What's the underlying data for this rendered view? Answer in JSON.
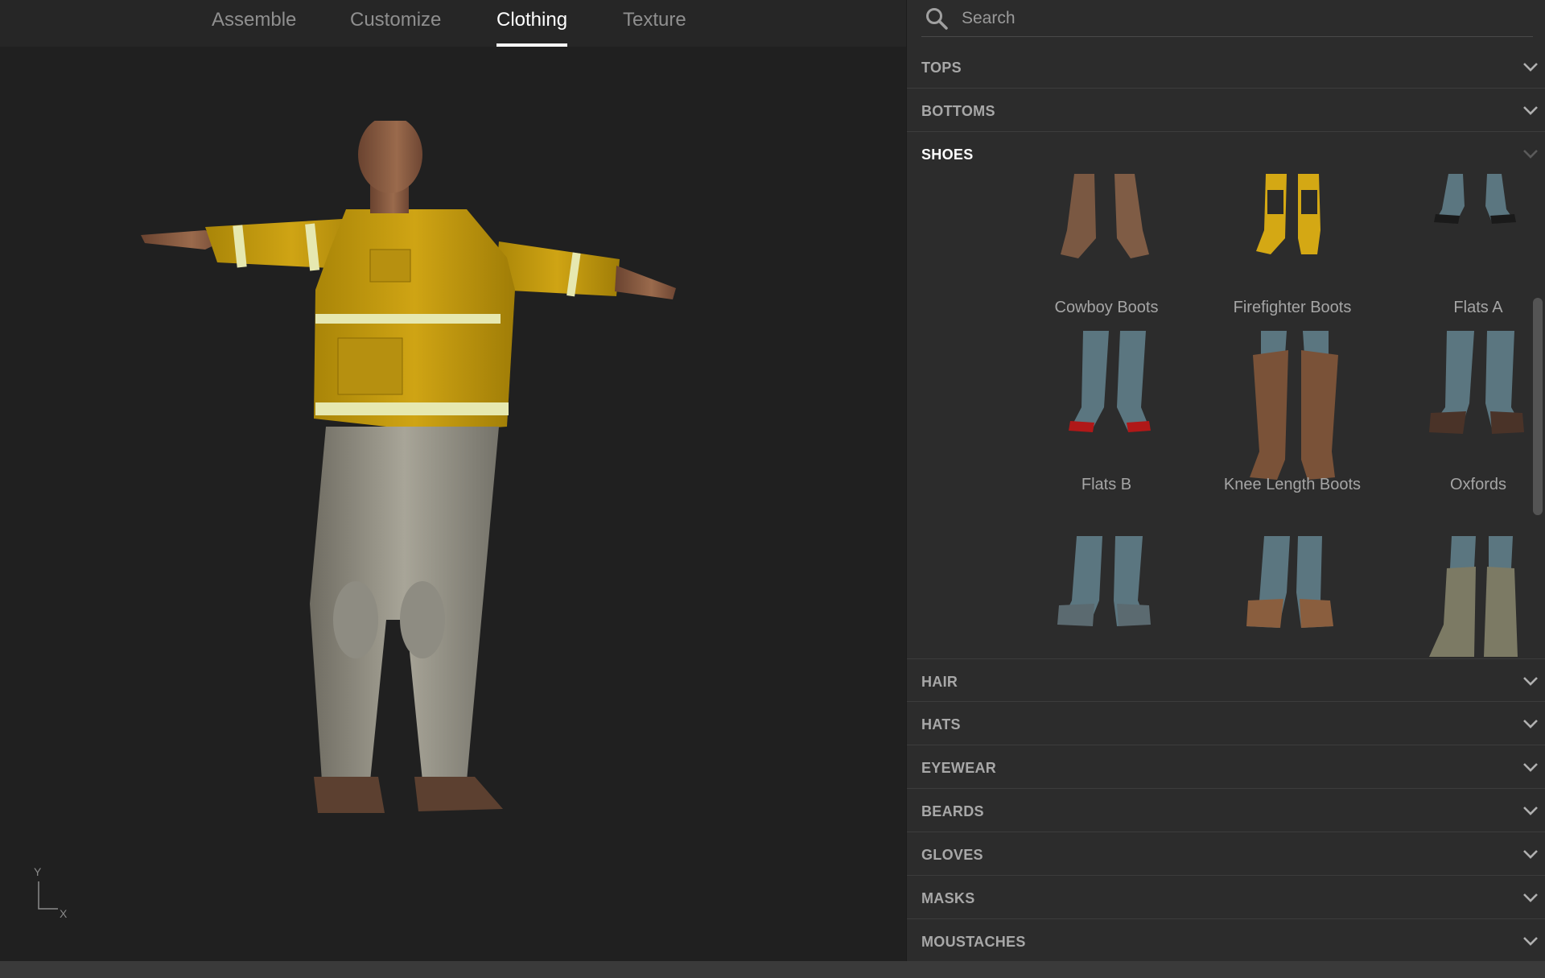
{
  "tabs": [
    {
      "label": "Assemble"
    },
    {
      "label": "Customize"
    },
    {
      "label": "Clothing"
    },
    {
      "label": "Texture"
    }
  ],
  "active_tab": "Clothing",
  "search": {
    "placeholder": "Search",
    "icon": "search-icon"
  },
  "categories": {
    "tops": "TOPS",
    "bottoms": "BOTTOMS",
    "shoes": "SHOES",
    "hair": "HAIR",
    "hats": "HATS",
    "eyewear": "EYEWEAR",
    "beards": "BEARDS",
    "gloves": "GLOVES",
    "masks": "MASKS",
    "moustaches": "MOUSTACHES"
  },
  "shoes": {
    "items": [
      {
        "label": "Cowboy Boots"
      },
      {
        "label": "Firefighter Boots"
      },
      {
        "label": "Flats A"
      },
      {
        "label": "Flats B"
      },
      {
        "label": "Knee Length Boots"
      },
      {
        "label": "Oxfords"
      }
    ]
  },
  "axis": {
    "y": "Y",
    "x": "X"
  },
  "colors": {
    "jacket": "#c9a010",
    "reflective": "#e6e8b0",
    "camo": "#8f8c80",
    "skin": "#8a5a3e",
    "sock": "#5b7680",
    "boot_brown": "#7a5238",
    "active_tab": "#ffffff"
  }
}
